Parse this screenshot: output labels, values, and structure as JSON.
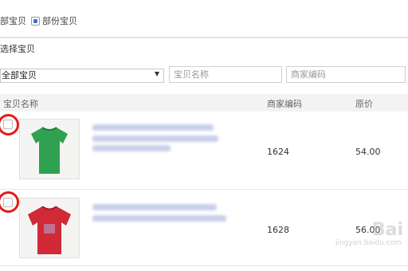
{
  "scope": {
    "option_all": "部宝贝",
    "option_partial": "部份宝贝"
  },
  "section_title": "选择宝贝",
  "filters": {
    "category_value": "全部宝贝",
    "name_placeholder": "宝贝名称",
    "code_placeholder": "商家编码"
  },
  "table": {
    "headers": {
      "name": "宝贝名称",
      "code": "商家编码",
      "price": "原价"
    },
    "rows": [
      {
        "code": "1624",
        "price": "54.00",
        "shirt_color": "#2fa150"
      },
      {
        "code": "1628",
        "price": "56.00",
        "shirt_color": "#cf2a36"
      }
    ]
  },
  "watermark": {
    "main": "Bai",
    "sub": "jingyan.baidu.com"
  },
  "colors": {
    "accent": "#3c6fd6",
    "highlight_ring": "#e31b1b"
  }
}
